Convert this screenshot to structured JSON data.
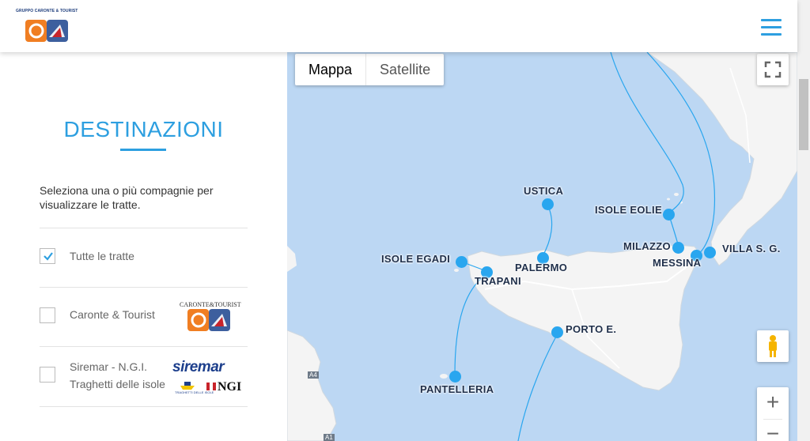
{
  "header": {
    "logo_text": "GRUPPO CARONTE & TOURIST",
    "logo_icon": "caronte-tourist-logo",
    "menu_icon": "hamburger-menu-icon",
    "accent_color": "#2d9fe0"
  },
  "sidebar": {
    "title": "DESTINAZIONI",
    "description": "Seleziona una o più compagnie per visualizzare le tratte.",
    "options": [
      {
        "label": "Tutte le tratte",
        "checked": true
      },
      {
        "label": "Caronte & Tourist",
        "checked": false,
        "logo_text": "CARONTE&TOURIST"
      },
      {
        "label_line1": "Siremar - N.G.I.",
        "label_line2": "Traghetti delle isole",
        "checked": false,
        "logo_siremar": "siremar",
        "logo_ngi": "NGI",
        "logo_sub": "TRAGHETTI DELLE ISOLE"
      }
    ]
  },
  "map": {
    "map_types": [
      "Mappa",
      "Satellite"
    ],
    "active_map_type": "Mappa",
    "cities": {
      "ustica": "USTICA",
      "isole_eolie": "ISOLE EOLIE",
      "isole_egadi": "ISOLE EGADI",
      "milazzo": "MILAZZO",
      "messina": "MESSINA",
      "villa": "VILLA S. G.",
      "palermo": "PALERMO",
      "trapani": "TRAPANI",
      "porto_e": "PORTO E.",
      "pantelleria": "PANTELLERIA"
    },
    "road_labels": {
      "a4": "A4",
      "a1": "A1"
    },
    "controls": {
      "fullscreen": "fullscreen-icon",
      "pegman": "pegman-icon",
      "zoom_in": "+",
      "zoom_out": "−"
    },
    "route_color": "#29a6ef"
  }
}
